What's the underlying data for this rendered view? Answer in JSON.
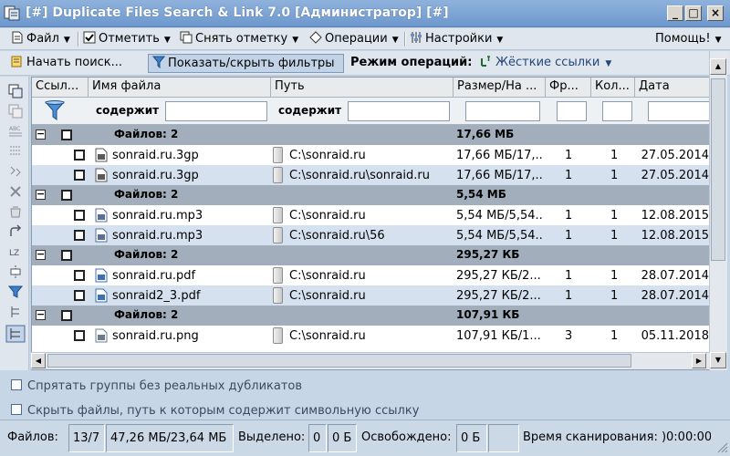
{
  "window": {
    "title": "[#] Duplicate Files Search & Link 7.0 [Администратор] [#]",
    "min_glyph": "_",
    "max_glyph": "□",
    "close_glyph": "×"
  },
  "menu": {
    "file": "Файл",
    "mark": "Отметить",
    "unmark": "Снять отметку",
    "operations": "Операции",
    "settings": "Настройки",
    "help": "Помощь!"
  },
  "toolbar": {
    "start_search": "Начать поиск...",
    "toggle_filters": "Показать/скрыть фильтры",
    "mode_label": "Режим операций:",
    "mode_value": "Жёсткие ссылки"
  },
  "columns": [
    "Ссыл...",
    "Имя файла",
    "Путь",
    "Размер/На ...",
    "Фр...",
    "Кол...",
    "Дата"
  ],
  "filter": {
    "name_contains": "содержит",
    "path_contains": "содержит"
  },
  "groups": [
    {
      "label": "Файлов: 2",
      "size": "17,66 МБ",
      "files": [
        {
          "name": "sonraid.ru.3gp",
          "path": "C:\\sonraid.ru",
          "size": "17,66 МБ/17,...",
          "fr": "1",
          "count": "1",
          "date": "27.05.2014",
          "icon": "video-file-icon"
        },
        {
          "name": "sonraid.ru.3gp",
          "path": "C:\\sonraid.ru\\sonraid.ru",
          "size": "17,66 МБ/17,...",
          "fr": "1",
          "count": "1",
          "date": "27.05.2014",
          "icon": "video-file-icon"
        }
      ]
    },
    {
      "label": "Файлов: 2",
      "size": "5,54 МБ",
      "files": [
        {
          "name": "sonraid.ru.mp3",
          "path": "C:\\sonraid.ru",
          "size": "5,54 МБ/5,54...",
          "fr": "1",
          "count": "1",
          "date": "12.08.2015",
          "icon": "audio-file-icon"
        },
        {
          "name": "sonraid.ru.mp3",
          "path": "C:\\sonraid.ru\\56",
          "size": "5,54 МБ/5,54...",
          "fr": "1",
          "count": "1",
          "date": "12.08.2015",
          "icon": "audio-file-icon"
        }
      ]
    },
    {
      "label": "Файлов: 2",
      "size": "295,27 КБ",
      "files": [
        {
          "name": "sonraid.ru.pdf",
          "path": "C:\\sonraid.ru",
          "size": "295,27 КБ/2...",
          "fr": "1",
          "count": "1",
          "date": "28.07.2014",
          "icon": "pdf-file-icon"
        },
        {
          "name": "sonraid2_3.pdf",
          "path": "C:\\sonraid.ru",
          "size": "295,27 КБ/2...",
          "fr": "1",
          "count": "1",
          "date": "28.07.2014",
          "icon": "pdf-file-icon"
        }
      ]
    },
    {
      "label": "Файлов: 2",
      "size": "107,91 КБ",
      "files": [
        {
          "name": "sonraid.ru.png",
          "path": "C:\\sonraid.ru",
          "size": "107,91 КБ/1...",
          "fr": "3",
          "count": "1",
          "date": "05.11.2018",
          "icon": "image-file-icon"
        }
      ]
    }
  ],
  "options": {
    "hide_groups": "Спрятать группы без реальных дубликатов",
    "hide_symlinks": "Скрыть файлы, путь к которым содержит символьную ссылку"
  },
  "status": {
    "files_label": "Файлов:",
    "files_count": "13/7",
    "files_size": "47,26 МБ/23,64 МБ",
    "selected_label": "Выделено:",
    "selected_count": "0",
    "selected_size": "0 Б",
    "freed_label": "Освобождено:",
    "freed_size": "0 Б",
    "scan_time": "Время сканирования: )0:00:00"
  },
  "colors": {
    "title_bar": "#6d98cd",
    "group_row": "#a2aebb",
    "alt_row": "#d5e1ee",
    "background": "#c7d6e6"
  }
}
